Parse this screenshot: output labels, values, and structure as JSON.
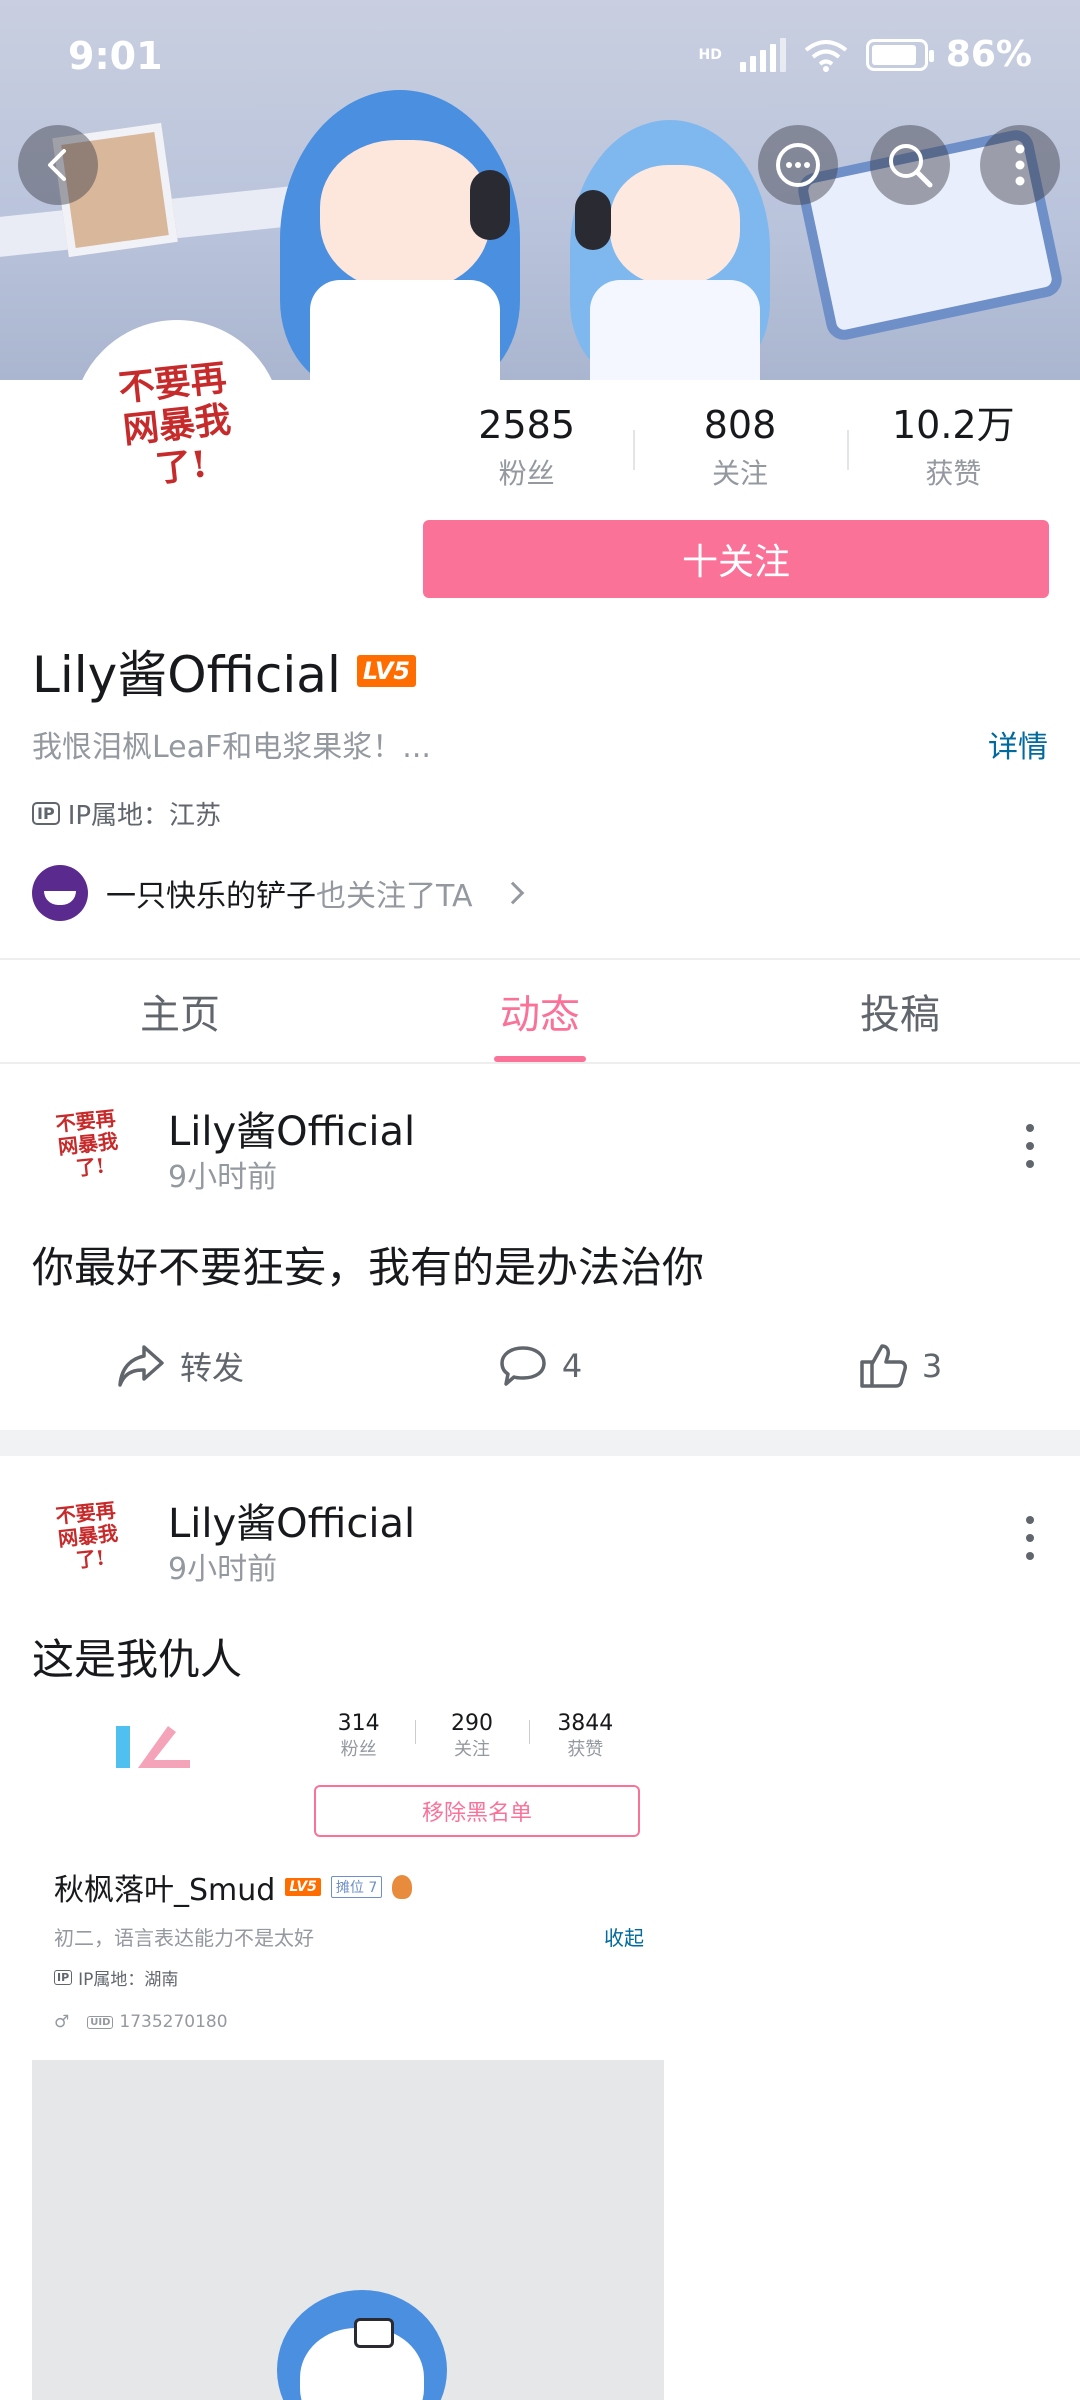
{
  "status_bar": {
    "time": "9:01",
    "network_label": "HD",
    "battery": "86%"
  },
  "profile": {
    "avatar_text": "不要再\n网暴我\n了!",
    "stats": [
      {
        "value": "2585",
        "label": "粉丝"
      },
      {
        "value": "808",
        "label": "关注"
      },
      {
        "value": "10.2万",
        "label": "获赞"
      }
    ],
    "follow_label": "十关注",
    "name": "Lily酱Official",
    "level": "LV5",
    "bio": "我恨泪枫LeaF和电浆果浆！...",
    "detail_link": "详情",
    "ip_icon": "IP",
    "ip": "IP属地：江苏",
    "mutual_name": "一只快乐的铲子",
    "mutual_suffix": "也关注了TA"
  },
  "tabs": [
    {
      "label": "主页",
      "active": false
    },
    {
      "label": "动态",
      "active": true
    },
    {
      "label": "投稿",
      "active": false
    }
  ],
  "posts": [
    {
      "avatar_text": "不要再\n网暴我\n了!",
      "author": "Lily酱Official",
      "time": "9小时前",
      "content": "你最好不要狂妄，我有的是办法治你",
      "actions": {
        "repost": "转发",
        "comments": "4",
        "likes": "3"
      }
    },
    {
      "avatar_text": "不要再\n网暴我\n了!",
      "author": "Lily酱Official",
      "time": "9小时前",
      "content": "这是我仇人",
      "embed": {
        "stats": [
          {
            "value": "314",
            "label": "粉丝"
          },
          {
            "value": "290",
            "label": "关注"
          },
          {
            "value": "3844",
            "label": "获赞"
          }
        ],
        "button": "移除黑名单",
        "name": "秋枫落叶_Smud",
        "level": "LV5",
        "tag": "摊位 7",
        "bio": "初二，语言表达能力不是太好",
        "collapse": "收起",
        "ip_icon": "IP",
        "ip": "IP属地：湖南",
        "gender": "♂",
        "uid_icon": "UID",
        "uid": "1735270180"
      }
    }
  ],
  "colors": {
    "accent": "#fb7299",
    "link": "#00699d",
    "level": "#ff6c00"
  }
}
